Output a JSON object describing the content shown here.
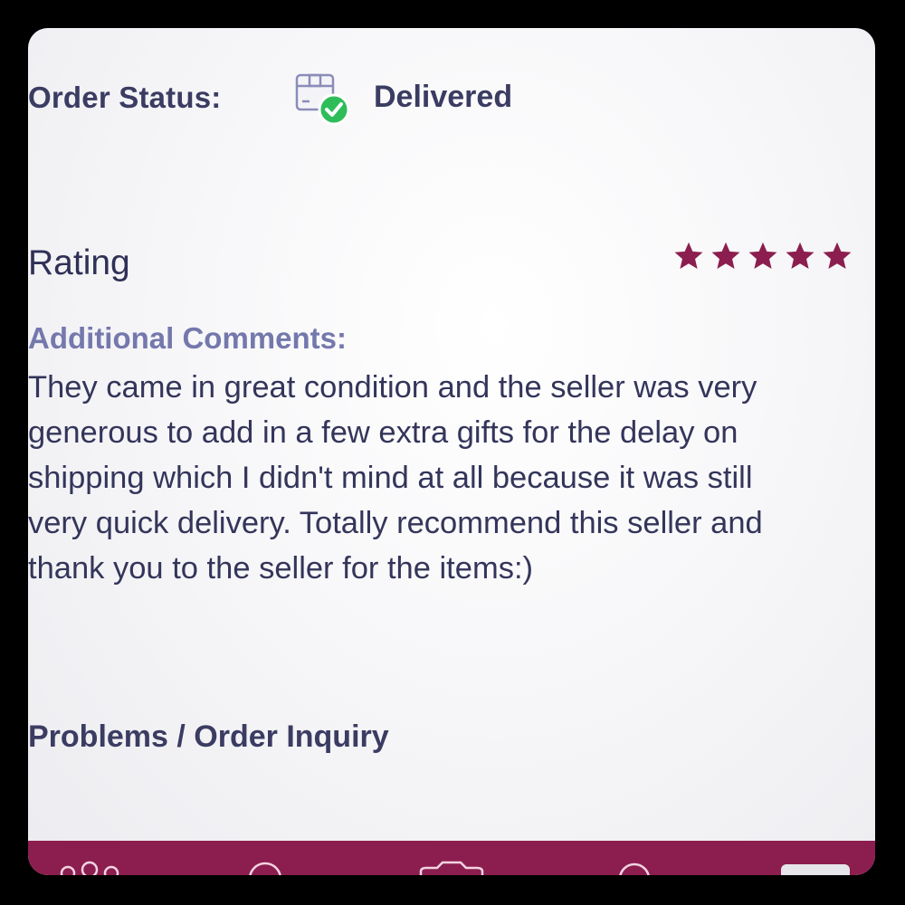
{
  "order": {
    "status_label": "Order Status:",
    "status_icon": "package-check-icon",
    "status_value": "Delivered"
  },
  "rating": {
    "label": "Rating",
    "stars": 5,
    "max_stars": 5,
    "star_color": "#8c1e4f"
  },
  "comments": {
    "label": "Additional Comments:",
    "text": "They came in great condition and the seller was very\ngenerous to add in a few extra gifts for the delay on\nshipping which I didn't mind at all because it was still\nvery quick delivery. Totally recommend this seller and\nthank you to the seller for the items:)"
  },
  "problems": {
    "label": "Problems / Order Inquiry"
  },
  "bottom_nav": {
    "color": "#8c1e4f",
    "items": [
      "community-icon",
      "search-icon",
      "camera-icon",
      "notifications-icon",
      "profile-icon"
    ]
  },
  "colors": {
    "text_dark": "#3b3c62",
    "text_accent": "#7478ac",
    "success_green": "#2fbd5a"
  }
}
